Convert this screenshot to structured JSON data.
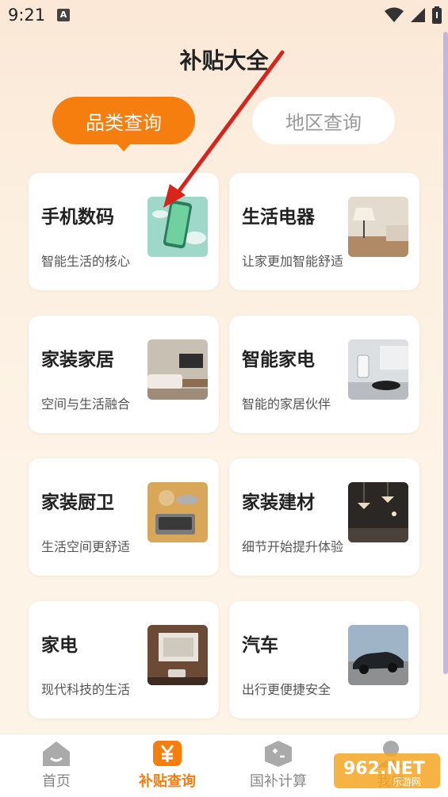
{
  "status": {
    "time": "9:21",
    "notif_icon": "A"
  },
  "page": {
    "title": "补贴大全"
  },
  "tabs": [
    {
      "label": "品类查询",
      "active": true
    },
    {
      "label": "地区查询",
      "active": false
    }
  ],
  "categories": [
    {
      "title": "手机数码",
      "subtitle": "智能生活的核心",
      "icon": "phone-image"
    },
    {
      "title": "生活电器",
      "subtitle": "让家更加智能舒适",
      "icon": "lamp-image"
    },
    {
      "title": "家装家居",
      "subtitle": "空间与生活融合",
      "icon": "living-room-image"
    },
    {
      "title": "智能家电",
      "subtitle": "智能的家居伙伴",
      "icon": "robot-vacuum-image"
    },
    {
      "title": "家装厨卫",
      "subtitle": "生活空间更舒适",
      "icon": "kitchen-image"
    },
    {
      "title": "家装建材",
      "subtitle": "细节开始提升体验",
      "icon": "chandelier-image"
    },
    {
      "title": "家电",
      "subtitle": "现代科技的生活",
      "icon": "projector-image"
    },
    {
      "title": "汽车",
      "subtitle": "出行更便捷安全",
      "icon": "car-image"
    }
  ],
  "nav": [
    {
      "label": "首页",
      "active": false
    },
    {
      "label": "补贴查询",
      "active": true
    },
    {
      "label": "国补计算",
      "active": false
    },
    {
      "label": "我的",
      "active": false
    }
  ],
  "watermark": {
    "text": "962.NET",
    "sub": "乐游网"
  },
  "colors": {
    "accent": "#f57e0f",
    "background": "#fdf3e6",
    "arrow": "#d9241c"
  }
}
